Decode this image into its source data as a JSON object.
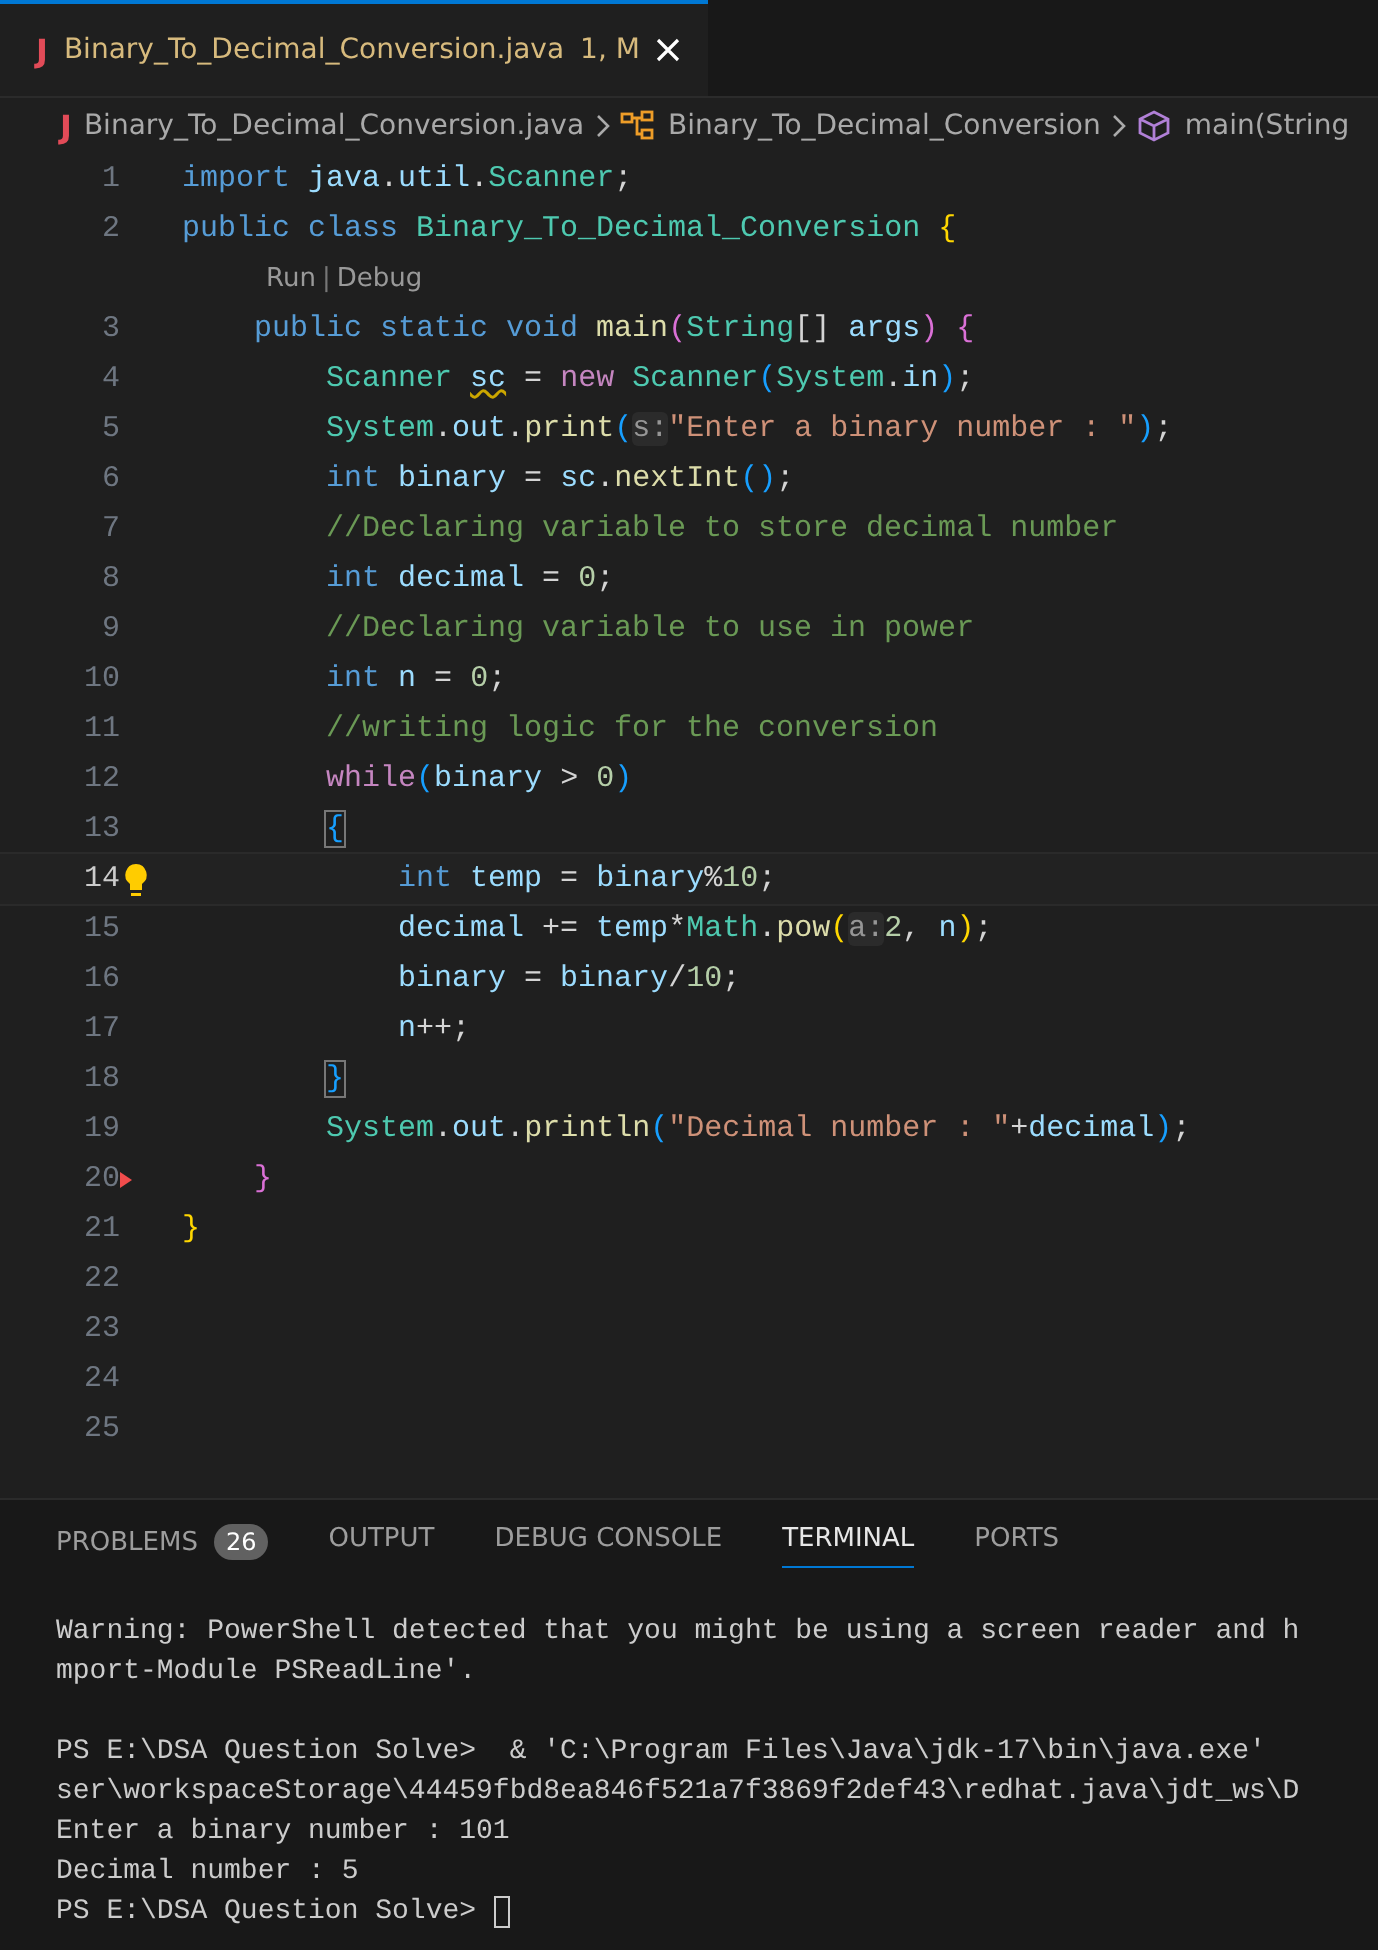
{
  "editor_tab": {
    "icon": "J",
    "title": "Binary_To_Decimal_Conversion.java",
    "status": "1, M",
    "selected": true
  },
  "breadcrumb": [
    {
      "kind": "file",
      "icon": "J",
      "label": "Binary_To_Decimal_Conversion.java"
    },
    {
      "kind": "class",
      "label": "Binary_To_Decimal_Conversion"
    },
    {
      "kind": "method",
      "label": "main(String"
    }
  ],
  "code_lines": [
    {
      "number": "1",
      "current": false,
      "tokens": [
        {
          "kind": "keyword",
          "text": "import"
        },
        {
          "kind": "variable",
          "text": " java"
        },
        {
          "kind": "plain",
          "text": "."
        },
        {
          "kind": "variable",
          "text": "util"
        },
        {
          "kind": "plain",
          "text": "."
        },
        {
          "kind": "type",
          "text": "Scanner"
        },
        {
          "kind": "plain",
          "text": ";"
        }
      ]
    },
    {
      "number": "2",
      "current": false,
      "tokens": [
        {
          "kind": "keyword",
          "text": "public class"
        },
        {
          "kind": "type",
          "text": " Binary_To_Decimal_Conversion"
        },
        {
          "kind": "bracket1",
          "text": " {"
        }
      ]
    },
    {
      "number": "3",
      "current": false,
      "code_lens_above": {
        "items": [
          "Run",
          "Debug"
        ],
        "separator": "|"
      },
      "tokens": [
        {
          "kind": "keyword",
          "text": "    public static"
        },
        {
          "kind": "keyword",
          "text": " void"
        },
        {
          "kind": "function",
          "text": " main"
        },
        {
          "kind": "bracket2",
          "text": "("
        },
        {
          "kind": "type",
          "text": "String"
        },
        {
          "kind": "plain",
          "text": "[]"
        },
        {
          "kind": "variable",
          "text": " args"
        },
        {
          "kind": "bracket2",
          "text": ")"
        },
        {
          "kind": "bracket2",
          "text": " {"
        }
      ]
    },
    {
      "number": "4",
      "current": false,
      "tokens": [
        {
          "kind": "type",
          "text": "        Scanner "
        },
        {
          "kind": "warning",
          "text": "sc"
        },
        {
          "kind": "plain",
          "text": " = "
        },
        {
          "kind": "control",
          "text": "new"
        },
        {
          "kind": "type",
          "text": " Scanner"
        },
        {
          "kind": "bracket3",
          "text": "("
        },
        {
          "kind": "type",
          "text": "System"
        },
        {
          "kind": "plain",
          "text": "."
        },
        {
          "kind": "variable",
          "text": "in"
        },
        {
          "kind": "bracket3",
          "text": ")"
        },
        {
          "kind": "plain",
          "text": ";"
        }
      ]
    },
    {
      "number": "5",
      "current": false,
      "tokens": [
        {
          "kind": "type",
          "text": "        System"
        },
        {
          "kind": "plain",
          "text": "."
        },
        {
          "kind": "variable",
          "text": "out"
        },
        {
          "kind": "plain",
          "text": "."
        },
        {
          "kind": "function",
          "text": "print"
        },
        {
          "kind": "bracket3",
          "text": "("
        },
        {
          "kind": "hint",
          "text": "s:"
        },
        {
          "kind": "string",
          "text": "\"Enter a binary number : \""
        },
        {
          "kind": "bracket3",
          "text": ")"
        },
        {
          "kind": "plain",
          "text": ";"
        }
      ]
    },
    {
      "number": "6",
      "current": false,
      "tokens": [
        {
          "kind": "keyword",
          "text": "        int"
        },
        {
          "kind": "variable",
          "text": " binary"
        },
        {
          "kind": "plain",
          "text": " = "
        },
        {
          "kind": "variable",
          "text": "sc"
        },
        {
          "kind": "plain",
          "text": "."
        },
        {
          "kind": "function",
          "text": "nextInt"
        },
        {
          "kind": "bracket3",
          "text": "()"
        },
        {
          "kind": "plain",
          "text": ";"
        }
      ]
    },
    {
      "number": "7",
      "current": false,
      "tokens": [
        {
          "kind": "comment",
          "text": "        //Declaring variable to store decimal number"
        }
      ]
    },
    {
      "number": "8",
      "current": false,
      "tokens": [
        {
          "kind": "keyword",
          "text": "        int"
        },
        {
          "kind": "variable",
          "text": " decimal"
        },
        {
          "kind": "plain",
          "text": " = "
        },
        {
          "kind": "number",
          "text": "0"
        },
        {
          "kind": "plain",
          "text": ";"
        }
      ]
    },
    {
      "number": "9",
      "current": false,
      "tokens": [
        {
          "kind": "comment",
          "text": "        //Declaring variable to use in power"
        }
      ]
    },
    {
      "number": "10",
      "current": false,
      "tokens": [
        {
          "kind": "keyword",
          "text": "        int"
        },
        {
          "kind": "variable",
          "text": " n"
        },
        {
          "kind": "plain",
          "text": " = "
        },
        {
          "kind": "number",
          "text": "0"
        },
        {
          "kind": "plain",
          "text": ";"
        }
      ]
    },
    {
      "number": "11",
      "current": false,
      "tokens": [
        {
          "kind": "comment",
          "text": "        //writing logic for the conversion"
        }
      ]
    },
    {
      "number": "12",
      "current": false,
      "tokens": [
        {
          "kind": "control",
          "text": "        while"
        },
        {
          "kind": "bracket3",
          "text": "("
        },
        {
          "kind": "variable",
          "text": "binary"
        },
        {
          "kind": "plain",
          "text": " > "
        },
        {
          "kind": "number",
          "text": "0"
        },
        {
          "kind": "bracket3",
          "text": ")"
        }
      ]
    },
    {
      "number": "13",
      "current": false,
      "tokens": [
        {
          "kind": "bracket3_match",
          "text": "        {"
        }
      ]
    },
    {
      "number": "14",
      "current": true,
      "tokens": [
        {
          "kind": "keyword",
          "text": "            int"
        },
        {
          "kind": "variable",
          "text": " temp"
        },
        {
          "kind": "plain",
          "text": " = "
        },
        {
          "kind": "variable",
          "text": "binary"
        },
        {
          "kind": "plain",
          "text": "%"
        },
        {
          "kind": "number",
          "text": "10"
        },
        {
          "kind": "plain",
          "text": ";"
        }
      ]
    },
    {
      "number": "15",
      "current": false,
      "tokens": [
        {
          "kind": "variable",
          "text": "            decimal"
        },
        {
          "kind": "plain",
          "text": " += "
        },
        {
          "kind": "variable",
          "text": "temp"
        },
        {
          "kind": "plain",
          "text": "*"
        },
        {
          "kind": "type",
          "text": "Math"
        },
        {
          "kind": "plain",
          "text": "."
        },
        {
          "kind": "function",
          "text": "pow"
        },
        {
          "kind": "bracket1",
          "text": "("
        },
        {
          "kind": "hint",
          "text": "a:"
        },
        {
          "kind": "number",
          "text": "2"
        },
        {
          "kind": "plain",
          "text": ", "
        },
        {
          "kind": "variable",
          "text": "n"
        },
        {
          "kind": "bracket1",
          "text": ")"
        },
        {
          "kind": "plain",
          "text": ";"
        }
      ]
    },
    {
      "number": "16",
      "current": false,
      "tokens": [
        {
          "kind": "variable",
          "text": "            binary"
        },
        {
          "kind": "plain",
          "text": " = "
        },
        {
          "kind": "variable",
          "text": "binary"
        },
        {
          "kind": "plain",
          "text": "/"
        },
        {
          "kind": "number",
          "text": "10"
        },
        {
          "kind": "plain",
          "text": ";"
        }
      ]
    },
    {
      "number": "17",
      "current": false,
      "tokens": [
        {
          "kind": "variable",
          "text": "            n"
        },
        {
          "kind": "plain",
          "text": "++;"
        }
      ]
    },
    {
      "number": "18",
      "current": false,
      "tokens": [
        {
          "kind": "bracket3_match",
          "text": "        }"
        }
      ]
    },
    {
      "number": "19",
      "current": false,
      "tokens": [
        {
          "kind": "type",
          "text": "        System"
        },
        {
          "kind": "plain",
          "text": "."
        },
        {
          "kind": "variable",
          "text": "out"
        },
        {
          "kind": "plain",
          "text": "."
        },
        {
          "kind": "function",
          "text": "println"
        },
        {
          "kind": "bracket3",
          "text": "("
        },
        {
          "kind": "string",
          "text": "\"Decimal number : \""
        },
        {
          "kind": "plain",
          "text": "+"
        },
        {
          "kind": "variable",
          "text": "decimal"
        },
        {
          "kind": "bracket3",
          "text": ")"
        },
        {
          "kind": "plain",
          "text": ";"
        }
      ]
    },
    {
      "number": "20",
      "current": false,
      "deleted_above": true,
      "tokens": [
        {
          "kind": "bracket2",
          "text": "    }"
        }
      ]
    },
    {
      "number": "21",
      "current": false,
      "tokens": [
        {
          "kind": "bracket1",
          "text": "}"
        }
      ]
    },
    {
      "number": "22",
      "current": false
    },
    {
      "number": "23",
      "current": false
    },
    {
      "number": "24",
      "current": false
    },
    {
      "number": "25",
      "current": false
    }
  ],
  "panel_tabs": [
    {
      "label": "PROBLEMS",
      "badge": "26",
      "selected": false
    },
    {
      "label": "OUTPUT",
      "selected": false
    },
    {
      "label": "DEBUG CONSOLE",
      "selected": false
    },
    {
      "label": "TERMINAL",
      "selected": true
    },
    {
      "label": "PORTS",
      "selected": false
    }
  ],
  "terminal_blocks": [
    [
      "Warning: PowerShell detected that you might be using a screen reader and h",
      "mport-Module PSReadLine'."
    ],
    [
      "PS E:\\DSA Question Solve>  & 'C:\\Program Files\\Java\\jdk-17\\bin\\java.exe'",
      "ser\\workspaceStorage\\44459fbd8ea846f521a7f3869f2def43\\redhat.java\\jdt_ws\\D",
      "Enter a binary number : 101",
      "Decimal number : 5",
      "PS E:\\DSA Question Solve>"
    ]
  ]
}
